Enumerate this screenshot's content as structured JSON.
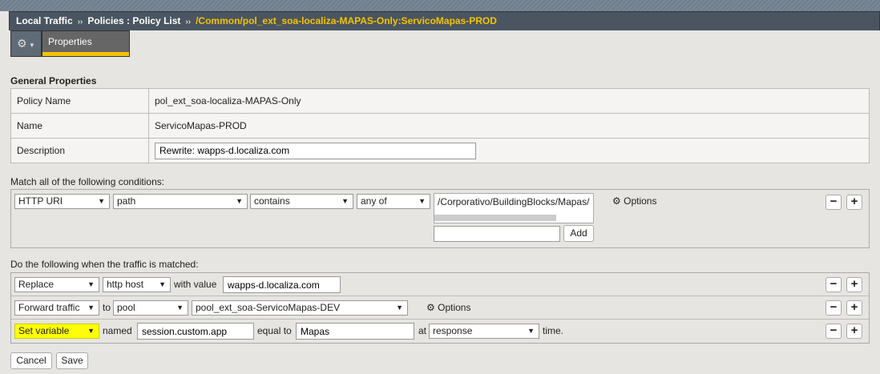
{
  "breadcrumb": {
    "items": [
      "Local Traffic",
      "Policies : Policy List"
    ],
    "current": "/Common/pol_ext_soa-localiza-MAPAS-Only:ServicoMapas-PROD",
    "separator": "››"
  },
  "tabs": {
    "active": "Properties"
  },
  "general": {
    "title": "General Properties",
    "rows": [
      {
        "label": "Policy Name",
        "value": "pol_ext_soa-localiza-MAPAS-Only"
      },
      {
        "label": "Name",
        "value": "ServicoMapas-PROD"
      },
      {
        "label": "Description",
        "value": "Rewrite: wapps-d.localiza.com"
      }
    ]
  },
  "conditions": {
    "title": "Match all of the following conditions:",
    "operand": "HTTP URI",
    "selector": "path",
    "operator": "contains",
    "quantifier": "any of",
    "values": [
      "/Corporativo/BuildingBlocks/Mapas/"
    ],
    "new_value": "",
    "add_label": "Add",
    "options_label": "Options"
  },
  "actions": {
    "title": "Do the following when the traffic is matched:",
    "rows": [
      {
        "action": "Replace",
        "target": "http host",
        "connector": "with value",
        "value": "wapps-d.localiza.com"
      },
      {
        "action": "Forward traffic",
        "connector": "to",
        "target": "pool",
        "value": "pool_ext_soa-ServicoMapas-DEV",
        "options_label": "Options"
      },
      {
        "action": "Set variable",
        "connector": "named",
        "name": "session.custom.app",
        "equal_label": "equal to",
        "value": "Mapas",
        "at_label": "at",
        "event": "response",
        "time_label": "time."
      }
    ]
  },
  "buttons": {
    "cancel": "Cancel",
    "save": "Save",
    "minus": "−",
    "plus": "+"
  },
  "colors": {
    "accent": "#f5c400",
    "highlight": "#ffff00"
  }
}
